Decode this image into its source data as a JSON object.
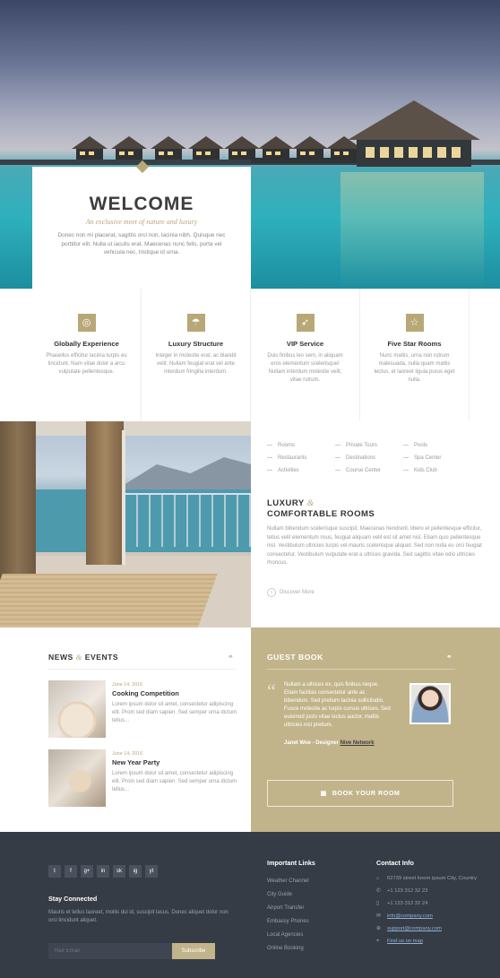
{
  "welcome": {
    "title": "WELCOME",
    "subtitle": "An exclusive meet of nature and luxury",
    "text": "Donec non mi placerat, sagittis orci non, lacinia nibh. Quisque nec porttitor elit. Nulla ut iaculis erat. Maecenas nunc felis, porta vel vehicula nec, tristique id urna."
  },
  "features": [
    {
      "icon": "globe-icon",
      "glyph": "◎",
      "title": "Globally Experience",
      "text": "Phasellus efficitur lacinia turpis eu tincidunt. Nam vitae dolor a arcu vulputate pellentesque."
    },
    {
      "icon": "umbrella-icon",
      "glyph": "☂",
      "title": "Luxury Structure",
      "text": "Integer in molestie erat, ac blandit velit. Nullam feugiat erat vel ante interdum fringilla interdum."
    },
    {
      "icon": "rocket-icon",
      "glyph": "➶",
      "title": "VIP Service",
      "text": "Duis finibus leo sem, in aliquam eros elementum scelerisque! Nullam interdum molestie velit, vitae rutrum."
    },
    {
      "icon": "star-icon",
      "glyph": "☆",
      "title": "Five Star Rooms",
      "text": "Nunc mattis, urna non rutrum malesuada, nulla quam mattis lectus, et laoreet ligula purus eget nulla."
    }
  ],
  "room": {
    "links": [
      [
        "Rooms",
        "Restaurants",
        "Activities"
      ],
      [
        "Private Tours",
        "Destinations",
        "Course Center"
      ],
      [
        "Pools",
        "Spa Center",
        "Kids Club"
      ]
    ],
    "title_line1": "LUXURY",
    "amp": "&",
    "title_line2": "COMFORTABLE ROOMS",
    "description": "Nullam bibendum scelerisque suscipit. Maecenas hendrerit, libero et pellentesque efficitur, tellus velit elementum risus, feugiat aliquam velit est sit amet nisl. Etiam quis pellentesque nisl. Vestibulum ultricies turpis vel mauris scelerisque aliquet. Sed non nulla eu orci feugiat consectetur. Vestibulum vulputate erat a ultrices gravida. Sed sagittis vitae odio ultricies rhoncus.",
    "discover": "Discover More"
  },
  "news": {
    "title_a": "NEWS",
    "amp": "&",
    "title_b": "EVENTS",
    "items": [
      {
        "date": "June 14, 2016",
        "title": "Cooking Competition",
        "text": "Lorem ipsum dolor sit amet, consectetur adipiscing elit. Proin sed diam sapien. Sed semper urna dictum tellus..."
      },
      {
        "date": "June 14, 2016",
        "title": "New Year Party",
        "text": "Lorem ipsum dolor sit amet, consectetur adipiscing elit. Proin sed diam sapien. Sed semper urna dictum tellus..."
      }
    ]
  },
  "guest": {
    "title": "GUEST BOOK",
    "quote": "Nullam a ultrices ex, quis finibus neque. Etiam facilisis consectetur ante ac bibendum. Sed pretium lacinia sollicitudin. Fusce molestie ac turpis cursus ultrices. Sed euismod justo vitae lectus auctor, mattis ultricies nisl pretium.",
    "author": "Janet Woe - Designer",
    "company": "Nive Network",
    "book_button": "BOOK YOUR ROOM"
  },
  "footer": {
    "social": [
      "t",
      "f",
      "g+",
      "in",
      "sk",
      "ig",
      "yt"
    ],
    "stay_title": "Stay Connected",
    "stay_text": "Mauris et tellus laoreet, mollis dui id, suscipit lacus. Donec aliquet dolor non orci tincidunt aliquet.",
    "email_placeholder": "Your Email",
    "subscribe": "Subscribe",
    "links_title": "Important Links",
    "links": [
      "Weather Channel",
      "City Guide",
      "Airport Transfer",
      "Embassy Phones",
      "Local Agencies",
      "Online Booking"
    ],
    "contact_title": "Contact Info",
    "contact": [
      {
        "icon": "home-icon",
        "glyph": "⌂",
        "text": "62739 street lorem ipsum City, Country",
        "link": false
      },
      {
        "icon": "phone-icon",
        "glyph": "✆",
        "text": "+1 123 312 32 23",
        "link": false
      },
      {
        "icon": "mobile-icon",
        "glyph": "▯",
        "text": "+1 123 312 32 24",
        "link": false
      },
      {
        "icon": "mail-icon",
        "glyph": "✉",
        "text": "info@company.com",
        "link": true
      },
      {
        "icon": "support-icon",
        "glyph": "⊕",
        "text": "support@company.com",
        "link": true
      },
      {
        "icon": "map-icon",
        "glyph": "⌖",
        "text": "Find us on map",
        "link": true
      }
    ]
  }
}
